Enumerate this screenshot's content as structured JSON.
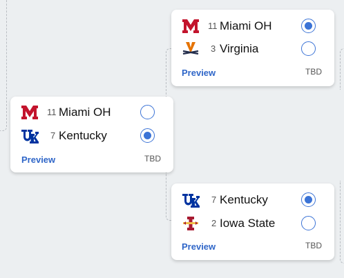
{
  "matchups": [
    {
      "teams": [
        {
          "seed": "11",
          "name": "Miami OH",
          "logo": "miami-oh-logo",
          "selected": true
        },
        {
          "seed": "3",
          "name": "Virginia",
          "logo": "virginia-logo",
          "selected": false
        }
      ],
      "preview_label": "Preview",
      "status": "TBD"
    },
    {
      "teams": [
        {
          "seed": "11",
          "name": "Miami OH",
          "logo": "miami-oh-logo",
          "selected": false
        },
        {
          "seed": "7",
          "name": "Kentucky",
          "logo": "kentucky-logo",
          "selected": true
        }
      ],
      "preview_label": "Preview",
      "status": "TBD"
    },
    {
      "teams": [
        {
          "seed": "7",
          "name": "Kentucky",
          "logo": "kentucky-logo",
          "selected": true
        },
        {
          "seed": "2",
          "name": "Iowa State",
          "logo": "iowa-state-logo",
          "selected": false
        }
      ],
      "preview_label": "Preview",
      "status": "TBD"
    }
  ],
  "colors": {
    "background": "#eceff1",
    "accent": "#3b73d6",
    "link": "#2f66c8",
    "miami_red": "#c3142d",
    "kentucky_blue": "#0033a0",
    "virginia_navy": "#232d4b",
    "virginia_orange": "#e57200",
    "iowa_state_cardinal": "#a71930",
    "iowa_state_gold": "#f1be48"
  }
}
